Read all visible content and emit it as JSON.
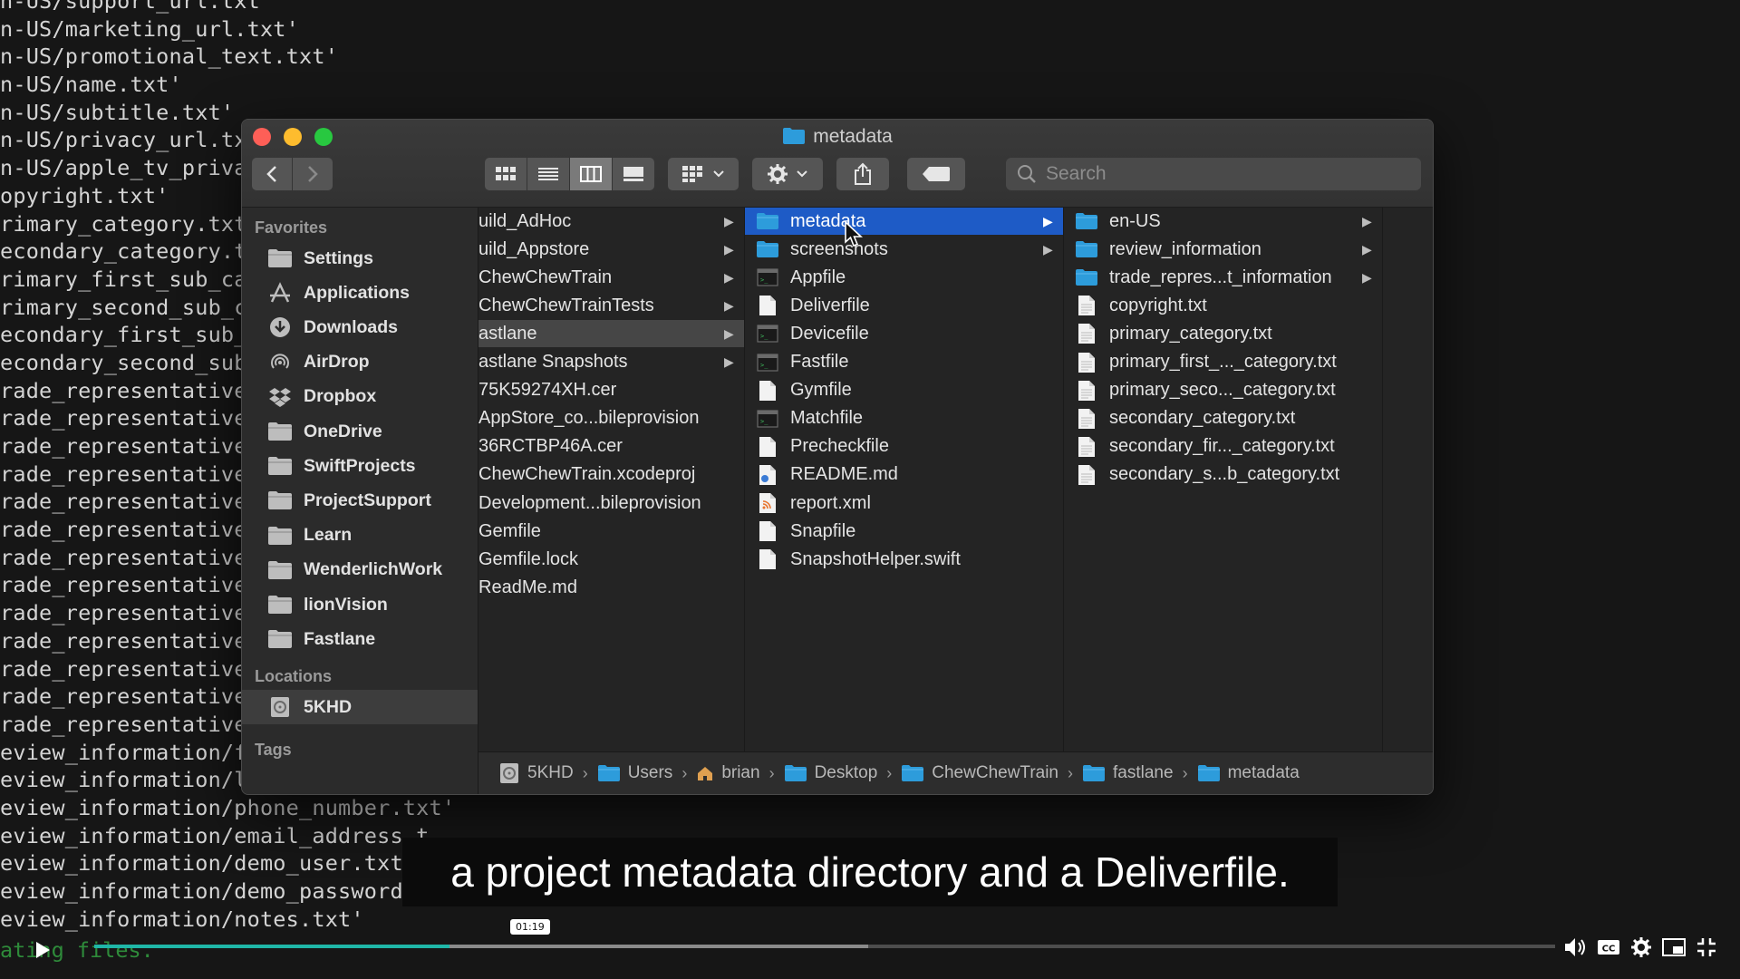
{
  "terminal": {
    "lines": [
      "n-US/support_url.txt'",
      "n-US/marketing_url.txt'",
      "n-US/promotional_text.txt'",
      "n-US/name.txt'",
      "n-US/subtitle.txt'",
      "n-US/privacy_url.txt",
      "n-US/apple_tv_privac",
      "opyright.txt'",
      "rimary_category.txt'",
      "econdary_category.tx",
      "rimary_first_sub_cat",
      "rimary_second_sub_ca",
      "econdary_first_sub_c",
      "econdary_second_sub_",
      "rade_representative_",
      "rade_representative_",
      "rade_representative_",
      "rade_representative_",
      "rade_representative_",
      "rade_representative_",
      "rade_representative_",
      "rade_representative_",
      "rade_representative_",
      "rade_representative_",
      "rade_representative_",
      "rade_representative_",
      "rade_representative_",
      "eview_information/fi",
      "eview_information/la",
      "eview_information/phone_number.txt'",
      "eview_information/email_address.t",
      "eview_information/demo_user.txt'",
      "eview_information/demo_password.t",
      "eview_information/notes.txt'"
    ],
    "last": "ating files."
  },
  "window": {
    "title": "metadata",
    "search_placeholder": "Search"
  },
  "sidebar": {
    "favorites_label": "Favorites",
    "favorites": [
      {
        "label": "Settings",
        "icon": "folder-icon"
      },
      {
        "label": "Applications",
        "icon": "applications-icon"
      },
      {
        "label": "Downloads",
        "icon": "downloads-icon"
      },
      {
        "label": "AirDrop",
        "icon": "airdrop-icon"
      },
      {
        "label": "Dropbox",
        "icon": "dropbox-icon"
      },
      {
        "label": "OneDrive",
        "icon": "folder-icon"
      },
      {
        "label": "SwiftProjects",
        "icon": "folder-icon"
      },
      {
        "label": "ProjectSupport",
        "icon": "folder-icon"
      },
      {
        "label": "Learn",
        "icon": "folder-icon"
      },
      {
        "label": "WenderlichWork",
        "icon": "folder-icon"
      },
      {
        "label": "lionVision",
        "icon": "folder-icon"
      },
      {
        "label": "Fastlane",
        "icon": "folder-icon"
      }
    ],
    "locations_label": "Locations",
    "locations": [
      {
        "label": "5KHD",
        "icon": "disk-icon"
      }
    ],
    "tags_label": "Tags"
  },
  "columns": {
    "col1": [
      {
        "label": "uild_AdHoc",
        "arrow": true
      },
      {
        "label": "uild_Appstore",
        "arrow": true
      },
      {
        "label": "ChewChewTrain",
        "arrow": true
      },
      {
        "label": "ChewChewTrainTests",
        "arrow": true
      },
      {
        "label": "astlane",
        "arrow": true,
        "selected": true
      },
      {
        "label": "astlane Snapshots",
        "arrow": true
      },
      {
        "label": "75K59274XH.cer",
        "arrow": false
      },
      {
        "label": "AppStore_co...bileprovision",
        "arrow": false
      },
      {
        "label": "36RCTBP46A.cer",
        "arrow": false
      },
      {
        "label": "ChewChewTrain.xcodeproj",
        "arrow": false
      },
      {
        "label": "Development...bileprovision",
        "arrow": false
      },
      {
        "label": "Gemfile",
        "arrow": false
      },
      {
        "label": "Gemfile.lock",
        "arrow": false
      },
      {
        "label": "ReadMe.md",
        "arrow": false
      }
    ],
    "col2": [
      {
        "label": "metadata",
        "icon": "folder-icon",
        "arrow": true,
        "selected": true
      },
      {
        "label": "screenshots",
        "icon": "folder-icon",
        "arrow": true
      },
      {
        "label": "Appfile",
        "icon": "exec-file-icon"
      },
      {
        "label": "Deliverfile",
        "icon": "document-icon"
      },
      {
        "label": "Devicefile",
        "icon": "exec-file-icon"
      },
      {
        "label": "Fastfile",
        "icon": "exec-file-icon"
      },
      {
        "label": "Gymfile",
        "icon": "document-icon"
      },
      {
        "label": "Matchfile",
        "icon": "exec-file-icon"
      },
      {
        "label": "Precheckfile",
        "icon": "document-icon"
      },
      {
        "label": "README.md",
        "icon": "markdown-file-icon"
      },
      {
        "label": "report.xml",
        "icon": "xml-file-icon"
      },
      {
        "label": "Snapfile",
        "icon": "document-icon"
      },
      {
        "label": "SnapshotHelper.swift",
        "icon": "document-icon"
      }
    ],
    "col3": [
      {
        "label": "en-US",
        "icon": "folder-icon",
        "arrow": true
      },
      {
        "label": "review_information",
        "icon": "folder-icon",
        "arrow": true
      },
      {
        "label": "trade_repres...t_information",
        "icon": "folder-icon",
        "arrow": true
      },
      {
        "label": "copyright.txt",
        "icon": "text-file-icon"
      },
      {
        "label": "primary_category.txt",
        "icon": "text-file-icon"
      },
      {
        "label": "primary_first_..._category.txt",
        "icon": "text-file-icon"
      },
      {
        "label": "primary_seco..._category.txt",
        "icon": "text-file-icon"
      },
      {
        "label": "secondary_category.txt",
        "icon": "text-file-icon"
      },
      {
        "label": "secondary_fir..._category.txt",
        "icon": "text-file-icon"
      },
      {
        "label": "secondary_s...b_category.txt",
        "icon": "text-file-icon"
      }
    ]
  },
  "pathbar": [
    {
      "label": "5KHD",
      "icon": "disk-icon"
    },
    {
      "label": "Users",
      "icon": "folder-icon"
    },
    {
      "label": "brian",
      "icon": "home-icon"
    },
    {
      "label": "Desktop",
      "icon": "folder-icon"
    },
    {
      "label": "ChewChewTrain",
      "icon": "folder-icon"
    },
    {
      "label": "fastlane",
      "icon": "folder-icon"
    },
    {
      "label": "metadata",
      "icon": "folder-icon"
    }
  ],
  "caption": "a project metadata directory and a Deliverfile.",
  "player": {
    "time": "01:19",
    "played_fraction": 0.243,
    "buffered_fraction": 0.53
  },
  "colors": {
    "selection": "#1e5bc6",
    "folder": "#2d9cdb",
    "progress": "#1fb7a8"
  }
}
